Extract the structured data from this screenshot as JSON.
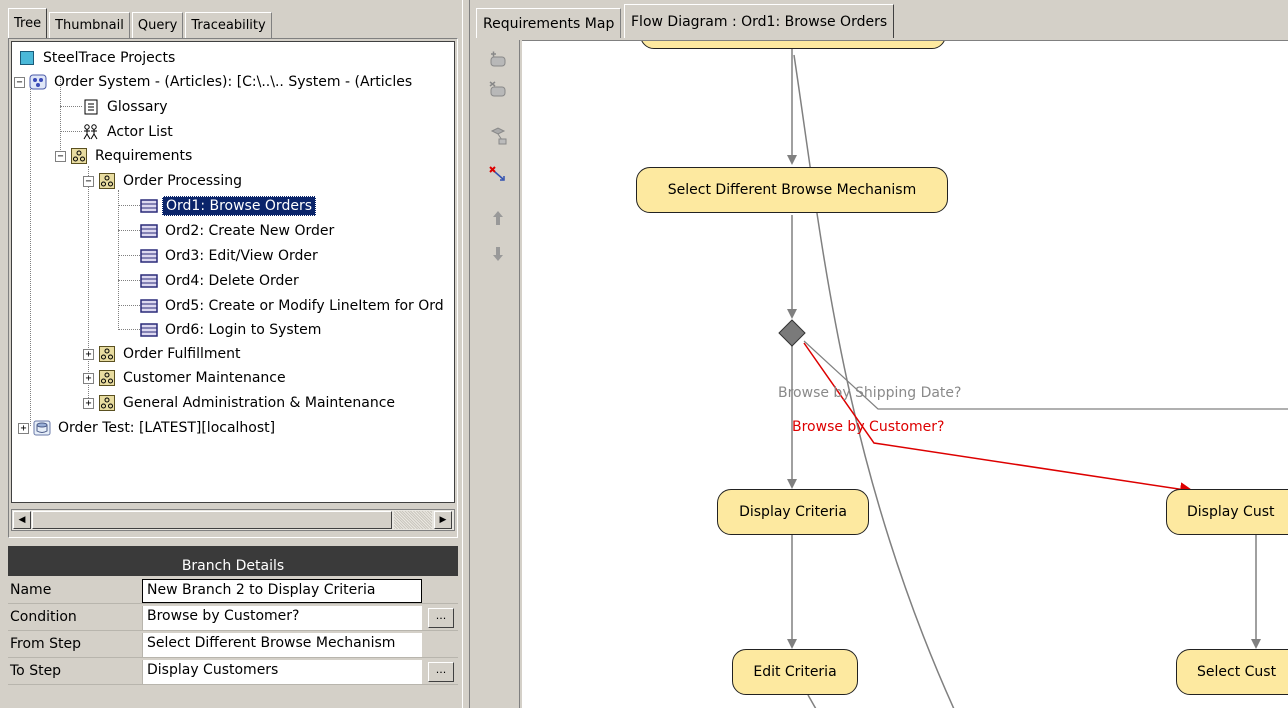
{
  "left_tabs": [
    "Tree",
    "Thumbnail",
    "Query",
    "Traceability"
  ],
  "tree": {
    "root": "SteelTrace Projects",
    "project": "Order System - (Articles): [C:\\..\\.. System - (Articles",
    "glossary": "Glossary",
    "actor_list": "Actor List",
    "requirements": "Requirements",
    "order_processing": "Order Processing",
    "items": [
      "Ord1: Browse Orders",
      "Ord2: Create New Order",
      "Ord3: Edit/View Order",
      "Ord4: Delete Order",
      "Ord5: Create or Modify LineItem for Ord",
      "Ord6: Login to System"
    ],
    "groups": [
      "Order Fulfillment",
      "Customer Maintenance",
      "General Administration & Maintenance"
    ],
    "order_test": "Order Test: [LATEST][localhost]"
  },
  "branch_details": {
    "title": "Branch Details",
    "rows": [
      {
        "label": "Name",
        "value": "New Branch 2 to Display Criteria"
      },
      {
        "label": "Condition",
        "value": "Browse by Customer?"
      },
      {
        "label": "From Step",
        "value": "Select Different Browse Mechanism"
      },
      {
        "label": "To Step",
        "value": "Display Customers"
      }
    ],
    "ellipsis": "..."
  },
  "right_tabs": [
    "Requirements Map",
    "Flow Diagram : Ord1: Browse Orders"
  ],
  "diagram": {
    "nodes": {
      "select_mechanism": "Select Different Browse Mechanism",
      "display_criteria": "Display Criteria",
      "display_customers": "Display Cust",
      "edit_criteria": "Edit Criteria",
      "select_customer": "Select Cust"
    },
    "labels": {
      "shipping": "Browse by Shipping Date?",
      "customer": "Browse by Customer?"
    },
    "colors": {
      "node_fill": "#fde9a0",
      "selected_edge": "#dd0000",
      "edge": "#808080"
    }
  }
}
